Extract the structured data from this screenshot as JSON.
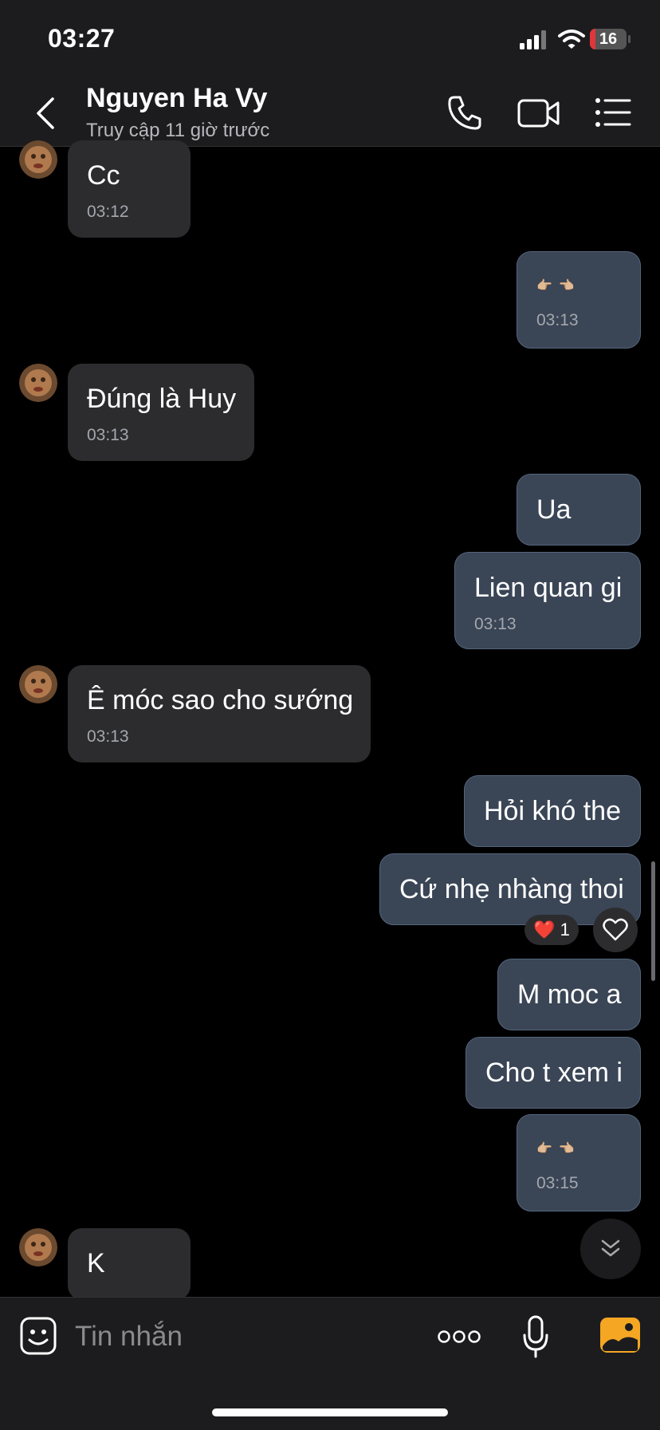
{
  "status_bar": {
    "time": "03:27",
    "battery": "16",
    "battery_level": 0.16,
    "battery_color": "#e0363b"
  },
  "header": {
    "contact_name": "Nguyen Ha Vy",
    "contact_status": "Truy cập 11 giờ trước",
    "icons": [
      "back-icon",
      "phone-icon",
      "video-call-icon",
      "list-menu-icon"
    ]
  },
  "messages": [
    {
      "id": "m1",
      "side": "incoming",
      "text": "Cc",
      "time": "03:12"
    },
    {
      "id": "m2",
      "side": "outgoing",
      "emoji": [
        "👉🏼",
        "👈🏼"
      ],
      "time": "03:13"
    },
    {
      "id": "m3",
      "side": "incoming",
      "text": "Đúng là Huy",
      "time": "03:13"
    },
    {
      "id": "m4",
      "side": "outgoing",
      "text": "Ua"
    },
    {
      "id": "m5",
      "side": "outgoing",
      "text": "Lien quan gi",
      "time": "03:13"
    },
    {
      "id": "m6",
      "side": "incoming",
      "text": "Ê móc sao cho sướng",
      "time": "03:13"
    },
    {
      "id": "m7",
      "side": "outgoing",
      "text": "Hỏi khó the"
    },
    {
      "id": "m8",
      "side": "outgoing",
      "text": "Cứ nhẹ nhàng thoi",
      "reaction": {
        "emoji": "❤️",
        "count": "1"
      }
    },
    {
      "id": "m9",
      "side": "outgoing",
      "text": "M moc a"
    },
    {
      "id": "m10",
      "side": "outgoing",
      "text": "Cho t xem i"
    },
    {
      "id": "m11",
      "side": "outgoing",
      "emoji": [
        "👉🏼",
        "👈🏼"
      ],
      "time": "03:15"
    },
    {
      "id": "m12",
      "side": "incoming",
      "text": "K"
    }
  ],
  "input_bar": {
    "placeholder": "Tin nhắn",
    "icons": [
      "sticker-icon",
      "more-icon",
      "microphone-icon",
      "gallery-icon"
    ]
  },
  "colors": {
    "incoming_bubble": "#2c2c2e",
    "outgoing_bubble": "#3a4556",
    "accent_orange": "#f5a623"
  }
}
